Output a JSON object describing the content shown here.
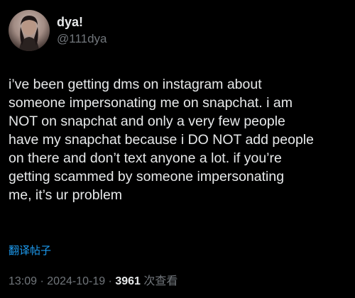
{
  "user": {
    "display_name": "dya!",
    "handle": "@111dya"
  },
  "tweet": {
    "lines": [
      "i’ve been getting dms on instagram about",
      "someone impersonating me on snapchat. i am",
      "NOT on snapchat and only a very few people",
      "have my snapchat because i DO NOT add people",
      "on there and don’t text anyone a lot. if you’re",
      "getting scammed by someone impersonating",
      "me, it’s ur problem"
    ],
    "translate_label": "翻译帖子",
    "time": "13:09",
    "separator": " · ",
    "date": "2024-10-19",
    "views_count": "3961",
    "views_label": "次查看"
  },
  "colors": {
    "background": "#000000",
    "text_primary": "#e7e9ea",
    "text_secondary": "#71767b",
    "link": "#1d9bf0"
  }
}
